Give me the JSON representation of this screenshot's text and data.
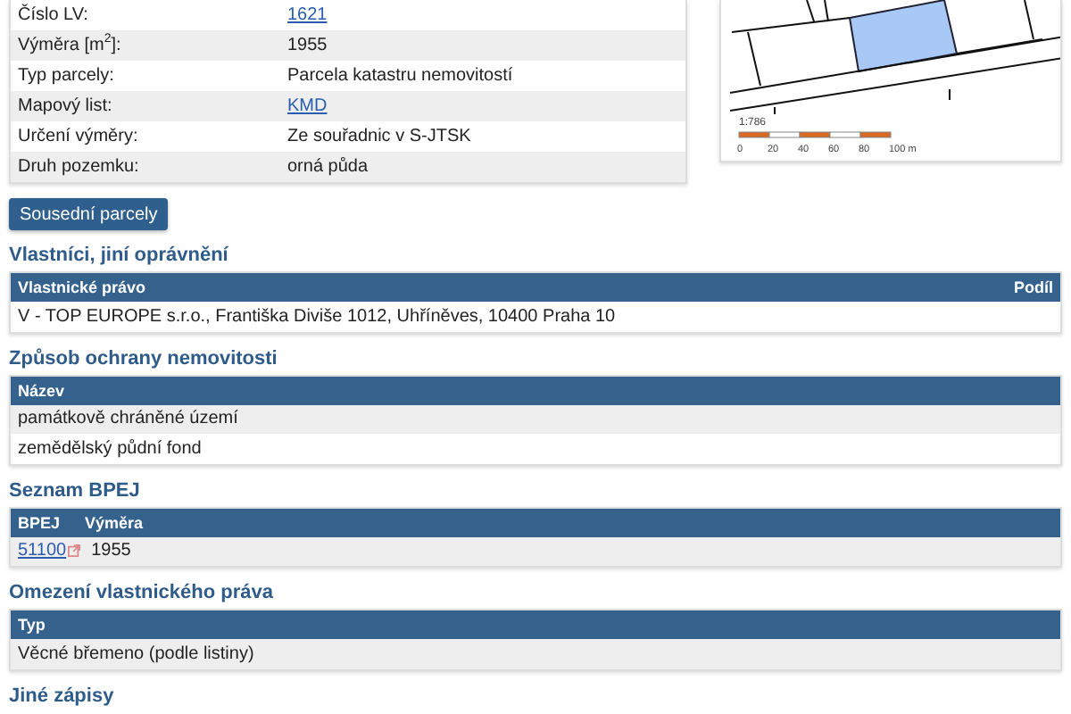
{
  "parcel_info": [
    {
      "label": "Číslo LV:",
      "value": "1621",
      "kind": "link"
    },
    {
      "label": "Výměra [m$^{2}$]:",
      "value": "1955",
      "kind": "text"
    },
    {
      "label": "Typ parcely:",
      "value": "Parcela katastru nemovitostí",
      "kind": "text"
    },
    {
      "label": "Mapový list:",
      "value": "KMD",
      "kind": "link"
    },
    {
      "label": "Určení výměry:",
      "value": "Ze souřadnic v S-JTSK",
      "kind": "text"
    },
    {
      "label": "Druh pozemku:",
      "value": "orná půda",
      "kind": "text"
    }
  ],
  "map": {
    "scale": "1:786",
    "scale_labels": [
      "0",
      "20",
      "40",
      "60",
      "80",
      "100 m"
    ]
  },
  "neighbors_button": "Sousední parcely",
  "sections": [
    {
      "title": "Vlastníci, jiní oprávnění",
      "columns": [
        "Vlastnické právo",
        "Podíl"
      ],
      "rows": [
        {
          "shaded": false,
          "cells": [
            {
              "text": "V - TOP EUROPE s.r.o., Františka Diviše 1012, Uhříněves, 10400 Praha 10",
              "kind": "text"
            }
          ]
        }
      ]
    },
    {
      "title": "Způsob ochrany nemovitosti",
      "columns": [
        "Název"
      ],
      "rows": [
        {
          "shaded": true,
          "cells": [
            {
              "text": "památkově chráněné území",
              "kind": "text"
            }
          ]
        },
        {
          "shaded": false,
          "cells": [
            {
              "text": "zemědělský půdní fond",
              "kind": "text"
            }
          ]
        }
      ]
    },
    {
      "title": "Seznam BPEJ",
      "columns": [
        "BPEJ",
        "Výměra"
      ],
      "rows": [
        {
          "shaded": true,
          "cells": [
            {
              "text": "51100",
              "kind": "external_link"
            },
            {
              "text": "1955",
              "kind": "text"
            }
          ]
        }
      ]
    },
    {
      "title": "Omezení vlastnického práva",
      "columns": [
        "Typ"
      ],
      "rows": [
        {
          "shaded": true,
          "cells": [
            {
              "text": "Věcné břemeno (podle listiny)",
              "kind": "text"
            }
          ]
        }
      ]
    },
    {
      "title": "Jiné zápisy"
    }
  ]
}
